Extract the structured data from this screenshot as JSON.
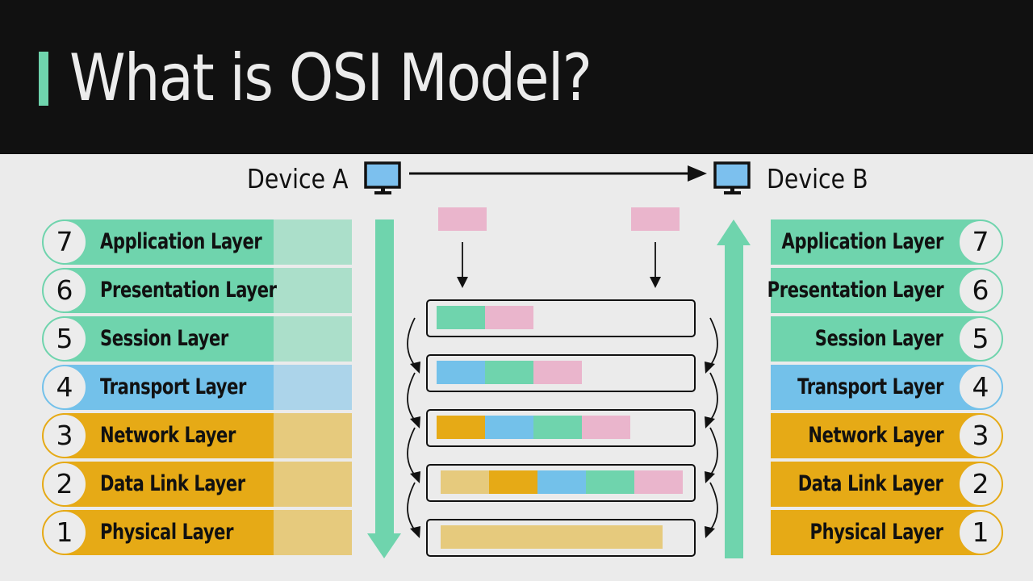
{
  "header": {
    "title": "What is OSI Model?",
    "accent_color": "#6fd4ad"
  },
  "devices": {
    "a": {
      "label": "Device A",
      "icon": "monitor-icon"
    },
    "b": {
      "label": "Device B",
      "icon": "monitor-icon"
    }
  },
  "colors": {
    "upper": "#6fd4ad",
    "upper_pale": "#abdfca",
    "transport": "#73c1ea",
    "transport_pale": "#acd4ea",
    "lower": "#e6aa16",
    "lower_pale": "#e6ca7d",
    "data": "#eab5cc",
    "frame_pale": "#e6ca7d"
  },
  "layers": [
    {
      "num": "7",
      "label": "Application Layer",
      "group": "upper"
    },
    {
      "num": "6",
      "label": "Presentation Layer",
      "group": "upper"
    },
    {
      "num": "5",
      "label": "Session Layer",
      "group": "upper"
    },
    {
      "num": "4",
      "label": "Transport Layer",
      "group": "transport"
    },
    {
      "num": "3",
      "label": "Network Layer",
      "group": "lower"
    },
    {
      "num": "2",
      "label": "Data Link  Layer",
      "group": "lower"
    },
    {
      "num": "1",
      "label": "Physical Layer",
      "group": "lower"
    }
  ],
  "encapsulation": {
    "data_block_color": "#eab5cc",
    "frames": [
      {
        "segments": [
          "upper",
          "data"
        ]
      },
      {
        "segments": [
          "transport",
          "upper",
          "data"
        ]
      },
      {
        "segments": [
          "lower",
          "transport",
          "upper",
          "data"
        ]
      },
      {
        "segments": [
          "lower_pale",
          "lower",
          "transport",
          "upper",
          "data"
        ]
      },
      {
        "segments": [
          "lower_pale_long"
        ]
      }
    ]
  },
  "flow": {
    "sender_direction": "down",
    "receiver_direction": "up"
  }
}
